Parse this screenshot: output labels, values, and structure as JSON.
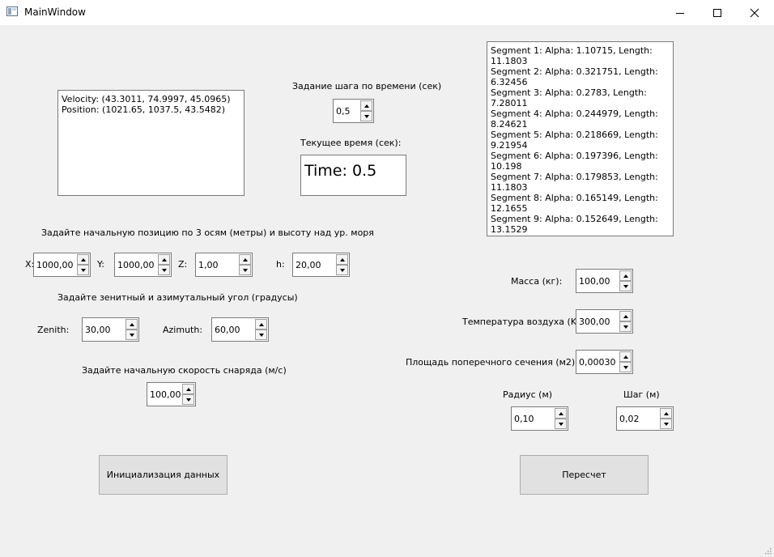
{
  "window": {
    "title": "MainWindow"
  },
  "output_text": "Velocity: (43.3011, 74.9997, 45.0965)\nPosition: (1021.65, 1037.5, 43.5482)",
  "segments_text": "Segment 1: Alpha: 1.10715, Length: 11.1803\nSegment 2: Alpha: 0.321751, Length: 6.32456\nSegment 3: Alpha: 0.2783, Length: 7.28011\nSegment 4: Alpha: 0.244979, Length: 8.24621\nSegment 5: Alpha: 0.218669, Length: 9.21954\nSegment 6: Alpha: 0.197396, Length: 10.198\nSegment 7: Alpha: 0.179853, Length: 11.1803\nSegment 8: Alpha: 0.165149, Length: 12.1655\nSegment 9: Alpha: 0.152649, Length: 13.1529",
  "time_step": {
    "label": "Задание шага по времени (сек)",
    "value": "0,5"
  },
  "current_time": {
    "label": "Текущее время (сек):",
    "text": "Time: 0.5"
  },
  "position": {
    "label": "Задайте начальную позицию по 3 осям (метры) и высоту над ур. моря",
    "x_label": "X:",
    "x_value": "1000,00",
    "y_label": "Y:",
    "y_value": "1000,00",
    "z_label": "Z:",
    "z_value": "1,00",
    "h_label": "h:",
    "h_value": "20,00"
  },
  "angles": {
    "label": "Задайте зенитный и азимутальный угол (градусы)",
    "zenith_label": "Zenith:",
    "zenith_value": "30,00",
    "azimuth_label": "Azimuth:",
    "azimuth_value": "60,00"
  },
  "speed": {
    "label": "Задайте начальную скорость снаряда (м/с)",
    "value": "100,00"
  },
  "mass": {
    "label": "Масса (кг):",
    "value": "100,00"
  },
  "temperature": {
    "label": "Температура воздуха (K):",
    "value": "300,00"
  },
  "area": {
    "label": "Площадь поперечного сечения (м2):",
    "value": "0,00030"
  },
  "radius": {
    "label": "Радиус (м)",
    "value": "0,10"
  },
  "step": {
    "label": "Шаг (м)",
    "value": "0,02"
  },
  "buttons": {
    "init": "Инициализация данных",
    "recalc": "Пересчет"
  }
}
